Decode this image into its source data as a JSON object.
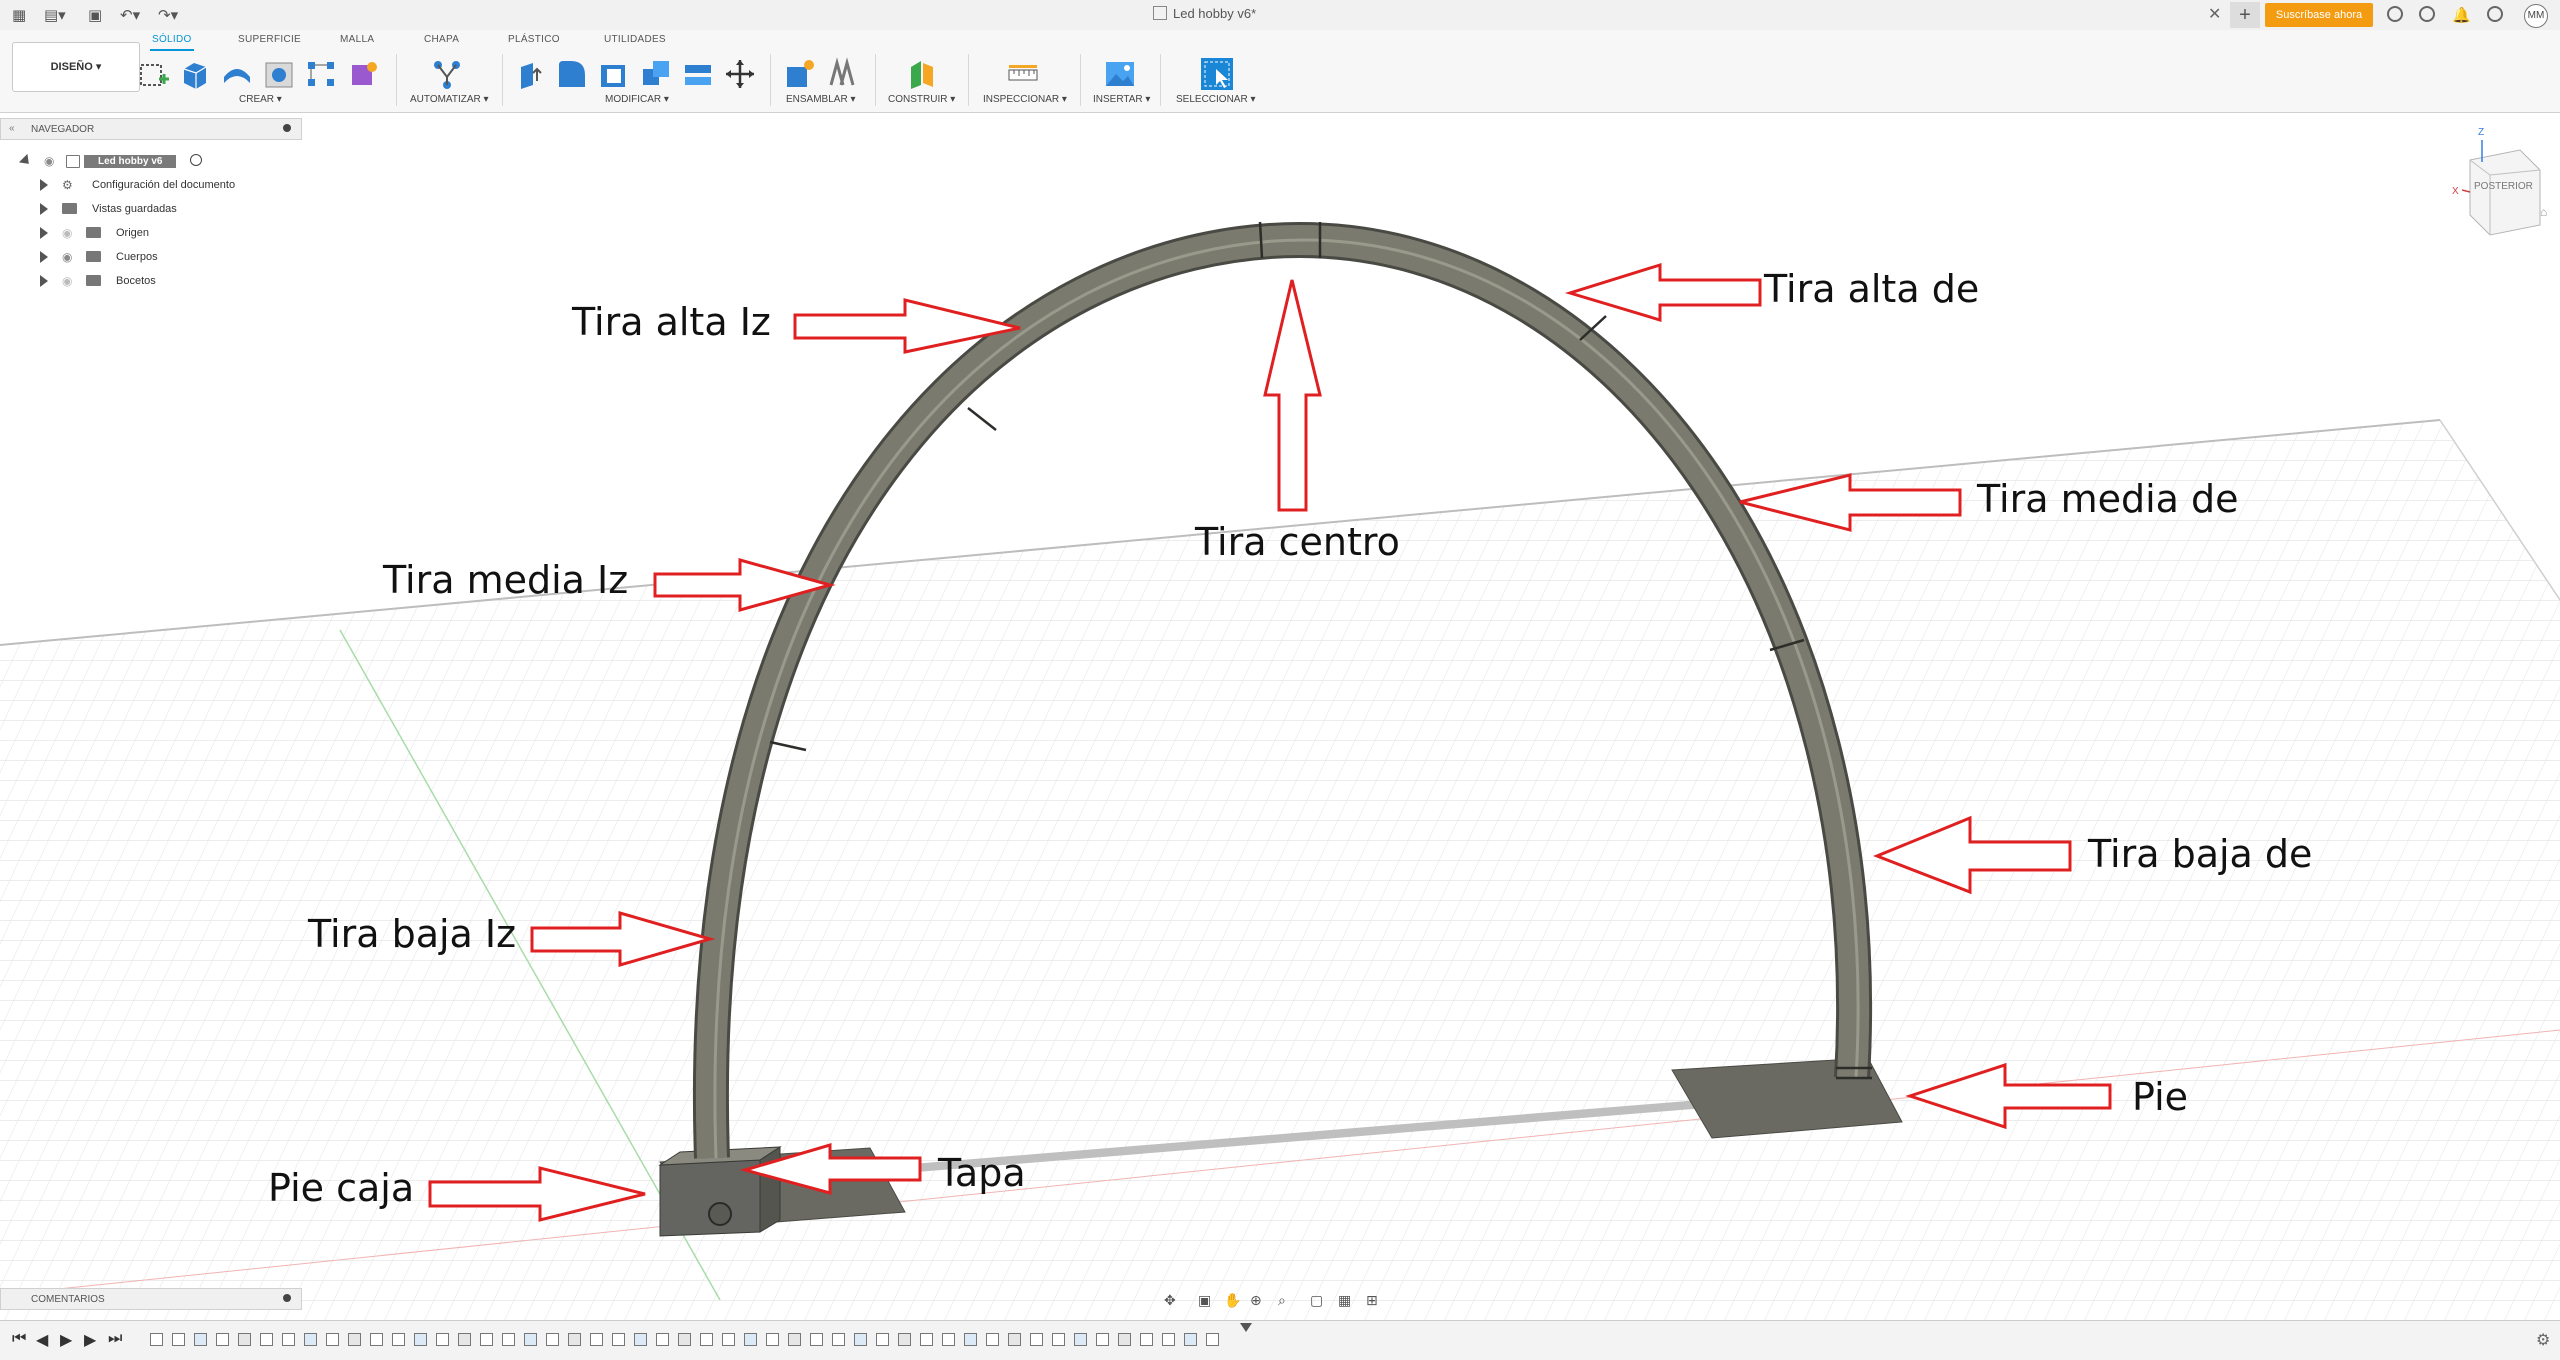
{
  "window": {
    "doc_tab_title": "Led hobby v6*",
    "subscribe_label": "Suscríbase ahora",
    "user_initials": "MM"
  },
  "ribbon": {
    "design_label": "DISEÑO ▾",
    "tabs": [
      "SÓLIDO",
      "SUPERFICIE",
      "MALLA",
      "CHAPA",
      "PLÁSTICO",
      "UTILIDADES"
    ],
    "groups": [
      "CREAR ▾",
      "AUTOMATIZAR ▾",
      "MODIFICAR ▾",
      "ENSAMBLAR ▾",
      "CONSTRUIR ▾",
      "INSPECCIONAR ▾",
      "INSERTAR ▾",
      "SELECCIONAR ▾"
    ]
  },
  "browser": {
    "title": "NAVEGADOR",
    "root": "Led hobby v6",
    "items": [
      "Configuración del documento",
      "Vistas guardadas",
      "Origen",
      "Cuerpos",
      "Bocetos"
    ]
  },
  "comments": {
    "title": "COMENTARIOS"
  },
  "viewcube": {
    "label": "POSTERIOR",
    "axis_z": "Z",
    "axis_x": "X"
  },
  "annotations": {
    "tira_alta_iz": "Tira alta Iz",
    "tira_alta_de": "Tira alta de",
    "tira_centro": "Tira centro",
    "tira_media_iz": "Tira media Iz",
    "tira_media_de": "Tira media de",
    "tira_baja_iz": "Tira baja Iz",
    "tira_baja_de": "Tira baja de",
    "pie_caja": "Pie caja",
    "tapa": "Tapa",
    "pie": "Pie"
  },
  "colors": {
    "accent": "#0696d7",
    "subscribe": "#f39c12",
    "arrow": "#e02020",
    "model": "#6e6e64"
  }
}
